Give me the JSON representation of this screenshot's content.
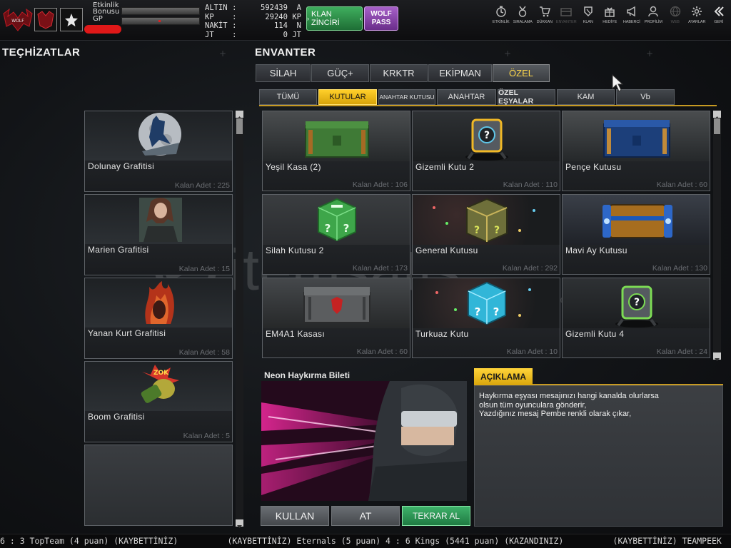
{
  "header": {
    "labels": {
      "etkinlik": "Etkinlik",
      "bonusu": "Bonusu",
      "gp": "GP"
    },
    "currencies": [
      {
        "label": "ALTIN",
        "sep": ":",
        "value": "592439",
        "unit": "A"
      },
      {
        "label": "KP",
        "sep": ":",
        "value": "29240",
        "unit": "KP"
      },
      {
        "label": "NAKİT",
        "sep": ":",
        "value": "114",
        "unit": "N"
      },
      {
        "label": "JT",
        "sep": ":",
        "value": "0",
        "unit": "JT"
      }
    ],
    "klan_button": "KLAN ZİNCİRİ",
    "wolf_button_line1": "WOLF",
    "wolf_button_line2": "PASS",
    "nav": [
      {
        "label": "ETKİNLİK",
        "icon": "clock-icon"
      },
      {
        "label": "SIRALAMA",
        "icon": "medal-icon"
      },
      {
        "label": "DÜKKAN",
        "icon": "cart-icon"
      },
      {
        "label": "ENVANTER",
        "icon": "inventory-icon"
      },
      {
        "label": "KLAN",
        "icon": "shield-icon"
      },
      {
        "label": "HEDİYE",
        "icon": "gift-icon"
      },
      {
        "label": "HABERCİ",
        "icon": "megaphone-icon"
      },
      {
        "label": "PROFİLİM",
        "icon": "profile-icon"
      },
      {
        "label": "WEB",
        "icon": "globe-icon"
      },
      {
        "label": "AYARLAR",
        "icon": "gear-icon"
      },
      {
        "label": "GERİ",
        "icon": "back-icon"
      }
    ]
  },
  "left": {
    "title": "TEÇHİZATLAR",
    "items": [
      {
        "name": "Dolunay Grafitisi",
        "count": "Kalan Adet : 225"
      },
      {
        "name": "Marien Grafitisi",
        "count": "Kalan Adet : 15"
      },
      {
        "name": "Yanan Kurt Grafitisi",
        "count": "Kalan Adet : 58"
      },
      {
        "name": "Boom Grafitisi",
        "count": "Kalan Adet : 5"
      },
      {
        "name": "",
        "count": ""
      }
    ]
  },
  "inventory": {
    "title": "ENVANTER",
    "tabs": [
      "SİLAH",
      "GÜÇ+",
      "KRKTR",
      "EKİPMAN",
      "ÖZEL"
    ],
    "subtabs": [
      "TÜMÜ",
      "KUTULAR",
      "ANAHTAR KUTUSU",
      "ANAHTAR",
      "ÖZEL EŞYALAR",
      "KAM",
      "Vb"
    ],
    "items": [
      {
        "name": "Yeşil Kasa (2)",
        "count": "Kalan Adet : 106"
      },
      {
        "name": "Gizemli Kutu 2",
        "count": "Kalan Adet : 110"
      },
      {
        "name": "Pençe Kutusu",
        "count": "Kalan Adet : 60"
      },
      {
        "name": "Silah Kutusu 2",
        "count": "Kalan Adet : 173"
      },
      {
        "name": "General Kutusu",
        "count": "Kalan Adet : 292"
      },
      {
        "name": "Mavi Ay Kutusu",
        "count": "Kalan Adet : 130"
      },
      {
        "name": "EM4A1 Kasası",
        "count": "Kalan Adet : 60"
      },
      {
        "name": "Turkuaz Kutu",
        "count": "Kalan Adet : 10"
      },
      {
        "name": "Gizemli Kutu 4",
        "count": "Kalan Adet : 24"
      }
    ]
  },
  "detail": {
    "name": "Neon Haykırma Bileti",
    "buttons": {
      "use": "KULLAN",
      "drop": "AT",
      "rebuy": "TEKRAR AL"
    },
    "desc_title": "AÇIKLAMA",
    "desc_lines": [
      "Haykırma eşyası mesajınızı hangi kanalda olurlarsa",
      "olsun tüm oyunculara gönderir,",
      "Yazdığınız mesaj Pembe renkli olarak çıkar,"
    ]
  },
  "ticker": "6 : 3 TopTeam (4 puan) (KAYBETTİNİZ)          (KAYBETTİNİZ) Eternals (5 puan) 4 : 6 Kings (5441 puan) (KAZANDINIZ)          (KAYBETTİNİZ) TEAMPEEK",
  "watermark": "itemsatis",
  "watermark_suffix": ".com",
  "colors": {
    "accent": "#ffcf2a",
    "green": "#2f9a55",
    "purple": "#8a45b0"
  }
}
